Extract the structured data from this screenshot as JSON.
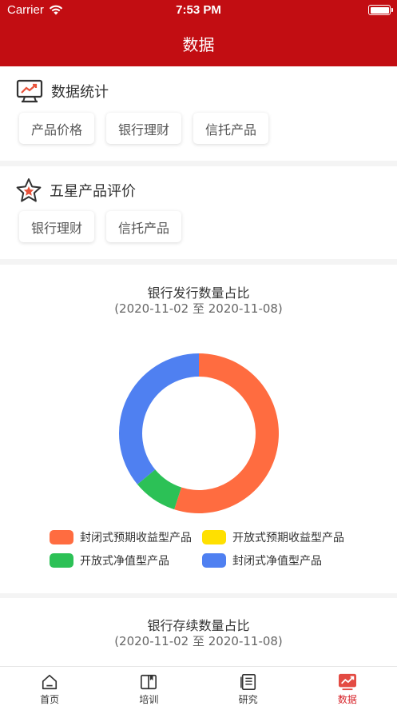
{
  "status_bar": {
    "carrier": "Carrier",
    "time": "7:53 PM"
  },
  "nav": {
    "title": "数据"
  },
  "stats_section": {
    "title": "数据统计",
    "icon": "trend-monitor-icon",
    "buttons": [
      "产品价格",
      "银行理财",
      "信托产品"
    ]
  },
  "rating_section": {
    "title": "五星产品评价",
    "icon": "star-icon",
    "buttons": [
      "银行理财",
      "信托产品"
    ]
  },
  "chart1": {
    "title": "银行发行数量占比",
    "subtitle": "(2020-11-02 至 2020-11-08)"
  },
  "chart2": {
    "title": "银行存续数量占比",
    "subtitle": "(2020-11-02 至 2020-11-08)"
  },
  "chart_data": {
    "type": "pie",
    "donut": true,
    "title": "银行发行数量占比",
    "subtitle": "(2020-11-02 至 2020-11-08)",
    "categories": [
      "封闭式预期收益型产品",
      "开放式预期收益型产品",
      "开放式净值型产品",
      "封闭式净值型产品"
    ],
    "values": [
      55,
      0,
      9,
      36
    ],
    "colors": [
      "#ff6c40",
      "#ffe000",
      "#2cc156",
      "#4f80f1"
    ],
    "legend_position": "bottom"
  },
  "tabbar": {
    "items": [
      {
        "label": "首页",
        "icon": "home-icon",
        "active": false
      },
      {
        "label": "培训",
        "icon": "book-icon",
        "active": false
      },
      {
        "label": "研究",
        "icon": "document-icon",
        "active": false
      },
      {
        "label": "数据",
        "icon": "chart-icon",
        "active": true
      }
    ]
  }
}
